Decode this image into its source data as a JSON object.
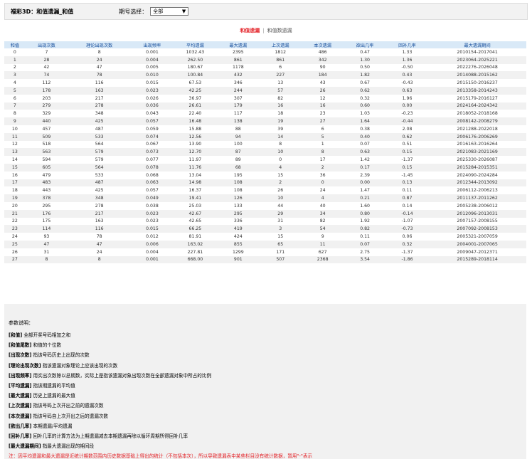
{
  "header": {
    "title": "福彩3D：和值遗漏_和值",
    "filter_label": "期号选择：",
    "filter_value": "全部"
  },
  "tabs": [
    {
      "label": "和值遗漏"
    },
    {
      "label": "和值数遗漏"
    }
  ],
  "table": {
    "columns": [
      "和值",
      "出现次数",
      "理论出现次数",
      "出现频率",
      "平均遗漏",
      "最大遗漏",
      "上次遗漏",
      "本次遗漏",
      "欲出几率",
      "回补几率",
      "最大遗漏期间"
    ],
    "rows": [
      [
        "0",
        "7",
        "8",
        "0.001",
        "1032.43",
        "2395",
        "1812",
        "486",
        "0.47",
        "1.33",
        "2010154-2017041"
      ],
      [
        "1",
        "28",
        "24",
        "0.004",
        "262.50",
        "861",
        "861",
        "342",
        "1.30",
        "1.36",
        "2023064-2025221"
      ],
      [
        "2",
        "42",
        "47",
        "0.005",
        "180.67",
        "1178",
        "6",
        "90",
        "0.50",
        "-0.50",
        "2022276-2026048"
      ],
      [
        "3",
        "74",
        "78",
        "0.010",
        "100.84",
        "432",
        "227",
        "184",
        "1.82",
        "0.43",
        "2014088-2015162"
      ],
      [
        "4",
        "112",
        "116",
        "0.015",
        "67.53",
        "346",
        "13",
        "43",
        "0.67",
        "-0.43",
        "2015150-2016237"
      ],
      [
        "5",
        "178",
        "163",
        "0.023",
        "42.25",
        "244",
        "57",
        "26",
        "0.62",
        "0.63",
        "2013358-2014243"
      ],
      [
        "6",
        "203",
        "217",
        "0.026",
        "36.97",
        "307",
        "82",
        "12",
        "0.32",
        "1.96",
        "2015179-2016127"
      ],
      [
        "7",
        "279",
        "278",
        "0.036",
        "26.61",
        "179",
        "16",
        "16",
        "0.60",
        "0.00",
        "2024164-2024342"
      ],
      [
        "8",
        "329",
        "348",
        "0.043",
        "22.40",
        "117",
        "18",
        "23",
        "1.03",
        "-0.23",
        "2018052-2018168"
      ],
      [
        "9",
        "440",
        "425",
        "0.057",
        "16.48",
        "138",
        "19",
        "27",
        "1.64",
        "-0.44",
        "2008142-2008279"
      ],
      [
        "10",
        "457",
        "487",
        "0.059",
        "15.88",
        "88",
        "39",
        "6",
        "0.38",
        "2.08",
        "2021288-2022018"
      ],
      [
        "11",
        "509",
        "533",
        "0.074",
        "12.56",
        "94",
        "14",
        "5",
        "0.40",
        "0.62",
        "2006176-2006269"
      ],
      [
        "12",
        "518",
        "564",
        "0.067",
        "13.90",
        "100",
        "8",
        "1",
        "0.07",
        "0.51",
        "2016163-2016264"
      ],
      [
        "13",
        "563",
        "579",
        "0.073",
        "12.70",
        "87",
        "10",
        "8",
        "0.63",
        "0.15",
        "2021083-2021169"
      ],
      [
        "14",
        "594",
        "579",
        "0.077",
        "11.97",
        "89",
        "0",
        "17",
        "1.42",
        "-1.37",
        "2025330-2026087"
      ],
      [
        "15",
        "605",
        "564",
        "0.078",
        "11.76",
        "68",
        "4",
        "2",
        "0.17",
        "0.15",
        "2015284-2015351"
      ],
      [
        "16",
        "479",
        "533",
        "0.068",
        "13.04",
        "195",
        "15",
        "36",
        "2.39",
        "-1.45",
        "2024090-2024284"
      ],
      [
        "17",
        "483",
        "487",
        "0.063",
        "14.98",
        "108",
        "2",
        "0",
        "0.00",
        "0.13",
        "2012344-2013092"
      ],
      [
        "18",
        "443",
        "425",
        "0.057",
        "16.37",
        "108",
        "26",
        "24",
        "1.47",
        "0.11",
        "2006112-2006213"
      ],
      [
        "19",
        "378",
        "348",
        "0.049",
        "19.41",
        "126",
        "10",
        "4",
        "0.21",
        "0.87",
        "2011137-2011262"
      ],
      [
        "20",
        "295",
        "278",
        "0.038",
        "25.03",
        "133",
        "44",
        "40",
        "1.60",
        "0.14",
        "2005238-2006012"
      ],
      [
        "21",
        "176",
        "217",
        "0.023",
        "42.67",
        "295",
        "29",
        "34",
        "0.80",
        "-0.14",
        "2012096-2013031"
      ],
      [
        "22",
        "175",
        "163",
        "0.023",
        "42.65",
        "336",
        "31",
        "82",
        "1.92",
        "-1.07",
        "2007157-2008155"
      ],
      [
        "23",
        "114",
        "116",
        "0.015",
        "66.25",
        "419",
        "3",
        "54",
        "0.82",
        "-0.73",
        "2007092-2008153"
      ],
      [
        "24",
        "93",
        "78",
        "0.012",
        "81.91",
        "424",
        "15",
        "9",
        "0.11",
        "0.06",
        "2005321-2007059"
      ],
      [
        "25",
        "47",
        "47",
        "0.006",
        "163.02",
        "855",
        "65",
        "11",
        "0.07",
        "0.32",
        "2004001-2007065"
      ],
      [
        "26",
        "31",
        "24",
        "0.004",
        "227.81",
        "1299",
        "171",
        "627",
        "2.75",
        "-1.37",
        "2009047-2012371"
      ],
      [
        "27",
        "8",
        "8",
        "0.001",
        "668.00",
        "901",
        "507",
        "2368",
        "3.54",
        "-1.86",
        "2015289-2018114"
      ]
    ]
  },
  "notes": {
    "heading": "参数说明：",
    "items": [
      {
        "term": "[和值]",
        "desc": "全部开奖号码相加之和"
      },
      {
        "term": "[和值尾数]",
        "desc": "和值的个位数"
      },
      {
        "term": "[出现次数]",
        "desc": "指该号码历史上出现的次数"
      },
      {
        "term": "[理论出现次数]",
        "desc": "指该遗漏对象理论上应该出现的次数"
      },
      {
        "term": "[出现频率]",
        "desc": "用实出次数除以总期数，实际上是指该遗漏对象出现次数在全部遗漏对象中所占的比例"
      },
      {
        "term": "[平均遗漏]",
        "desc": "指该期遗漏的平均值"
      },
      {
        "term": "[最大遗漏]",
        "desc": "历史上遗漏的最大值"
      },
      {
        "term": "[上次遗漏]",
        "desc": "指该号码上次开出之前的遗漏次数"
      },
      {
        "term": "[本次遗漏]",
        "desc": "指该号码自上次开出之后的遗漏次数"
      },
      {
        "term": "[欲出几率]",
        "desc": "本期遗漏/平均遗漏"
      },
      {
        "term": "[回补几率]",
        "desc": "回补几率的计算方法为上期遗漏减去本期遗漏再除以循环周期所得回补几率"
      },
      {
        "term": "[最大遗漏期间]",
        "desc": "指最大遗漏出现的期间段"
      }
    ],
    "footnote": "注：因平均遗漏和最大遗漏是近统计期数范围内历史数据基础上得出的统计（不包括本次），所以导致遗漏表中某些栏目没有统计数据，暂用\"-\"表示"
  }
}
